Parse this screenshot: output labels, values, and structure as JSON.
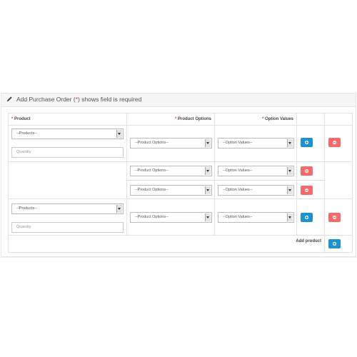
{
  "heading": {
    "prefix": "Add Purchase Order",
    "req_open": "(",
    "req_star": "*",
    "req_close": ")",
    "suffix": "shows field is required"
  },
  "columns": {
    "product": "Product",
    "product_options": "Product Options",
    "option_values": "Option Values",
    "required_star": "*"
  },
  "rows": [
    {
      "product_select": "--Products--",
      "quantity_placeholder": "Quantity",
      "product_option": "--Product Options--",
      "option_value": "--Option Values--"
    },
    {
      "sub": [
        {
          "product_option": "--Product Options--",
          "option_value": "--Option Values--"
        },
        {
          "product_option": "--Product Options--",
          "option_value": "--Option Values--"
        }
      ]
    },
    {
      "product_select": "--Products--",
      "quantity_placeholder": "Quantity",
      "product_option": "--Product Options--",
      "option_value": "--Option Values--"
    }
  ],
  "footer": {
    "add_product_label": "Add product"
  },
  "colors": {
    "blue_button": "#1e91cf",
    "red_button": "#f56b6b",
    "required": "#e03a3a"
  }
}
